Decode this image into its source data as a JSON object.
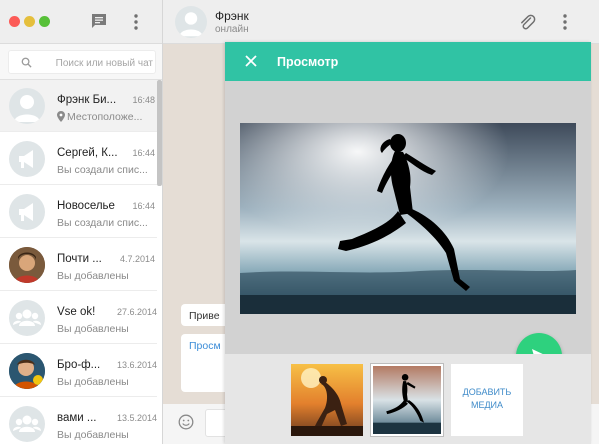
{
  "sidebar": {
    "search_placeholder": "Поиск или новый чат",
    "chats": [
      {
        "name": "Фрэнк Би...",
        "time": "16:48",
        "preview": "Местоположе...",
        "has_pin": true,
        "avatar": "person-icon"
      },
      {
        "name": "Сергей, К...",
        "time": "16:44",
        "preview": "Вы создали спис...",
        "avatar": "megaphone-icon"
      },
      {
        "name": "Новоселье",
        "time": "16:44",
        "preview": "Вы создали спис...",
        "avatar": "megaphone-icon"
      },
      {
        "name": "Почти ...",
        "time": "4.7.2014",
        "preview": "Вы добавлены",
        "avatar": "photo"
      },
      {
        "name": "Vse ok!",
        "time": "27.6.2014",
        "preview": "Вы добавлены",
        "avatar": "group-icon"
      },
      {
        "name": "Бро-ф...",
        "time": "13.6.2014",
        "preview": "Вы добавлены",
        "avatar": "photo"
      },
      {
        "name": "вами ...",
        "time": "13.5.2014",
        "preview": "Вы добавлены",
        "avatar": "group-icon"
      }
    ]
  },
  "chat": {
    "title": "Фрэнк",
    "status": "онлайн",
    "bubbles": [
      "Приве",
      "Просм"
    ]
  },
  "preview": {
    "title": "Просмотр",
    "add_media": "ДОБАВИТЬ МЕДИА"
  },
  "colors": {
    "accent": "#30c3a4",
    "send": "#2ed17e",
    "link": "#3f8bc9"
  }
}
